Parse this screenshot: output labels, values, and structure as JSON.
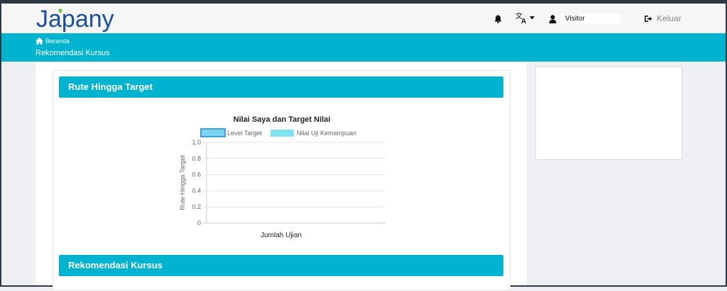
{
  "app": {
    "logo_text": "Japany"
  },
  "navbar": {
    "user_name": "Visitor",
    "logout_label": "Keluar",
    "icons": {
      "notification": "bell-icon",
      "language": "translate-icon",
      "user": "user-icon",
      "logout": "logout-icon"
    }
  },
  "breadcrumb": {
    "home_label": "Beranda",
    "current": "Rekomendasi Kursus"
  },
  "cards": {
    "route_title": "Rute Hingga Target",
    "courses_title": "Rekomendasi Kursus"
  },
  "colors": {
    "accent": "#00b4cf",
    "logo_blue": "#1a4fa0",
    "logo_green": "#6cc04a"
  },
  "chart_data": {
    "type": "bar",
    "title": "Nilai Saya dan Target Nilai",
    "xlabel": "Jumlah Ujian",
    "ylabel": "Rute Hingga Target",
    "ylim": [
      0,
      1
    ],
    "y_ticks": [
      "1.0",
      "0.8",
      "0.6",
      "0.4",
      "0.2",
      "0"
    ],
    "categories": [],
    "legend_position": "top",
    "grid": true,
    "series": [
      {
        "name": "Level Target",
        "values": [],
        "color": "#7fd3f2",
        "border": "#3aa3e0"
      },
      {
        "name": "Nilai Uji Kemampuan",
        "values": [],
        "color": "#7fe3f2",
        "border": "#7fe3f2"
      }
    ]
  }
}
